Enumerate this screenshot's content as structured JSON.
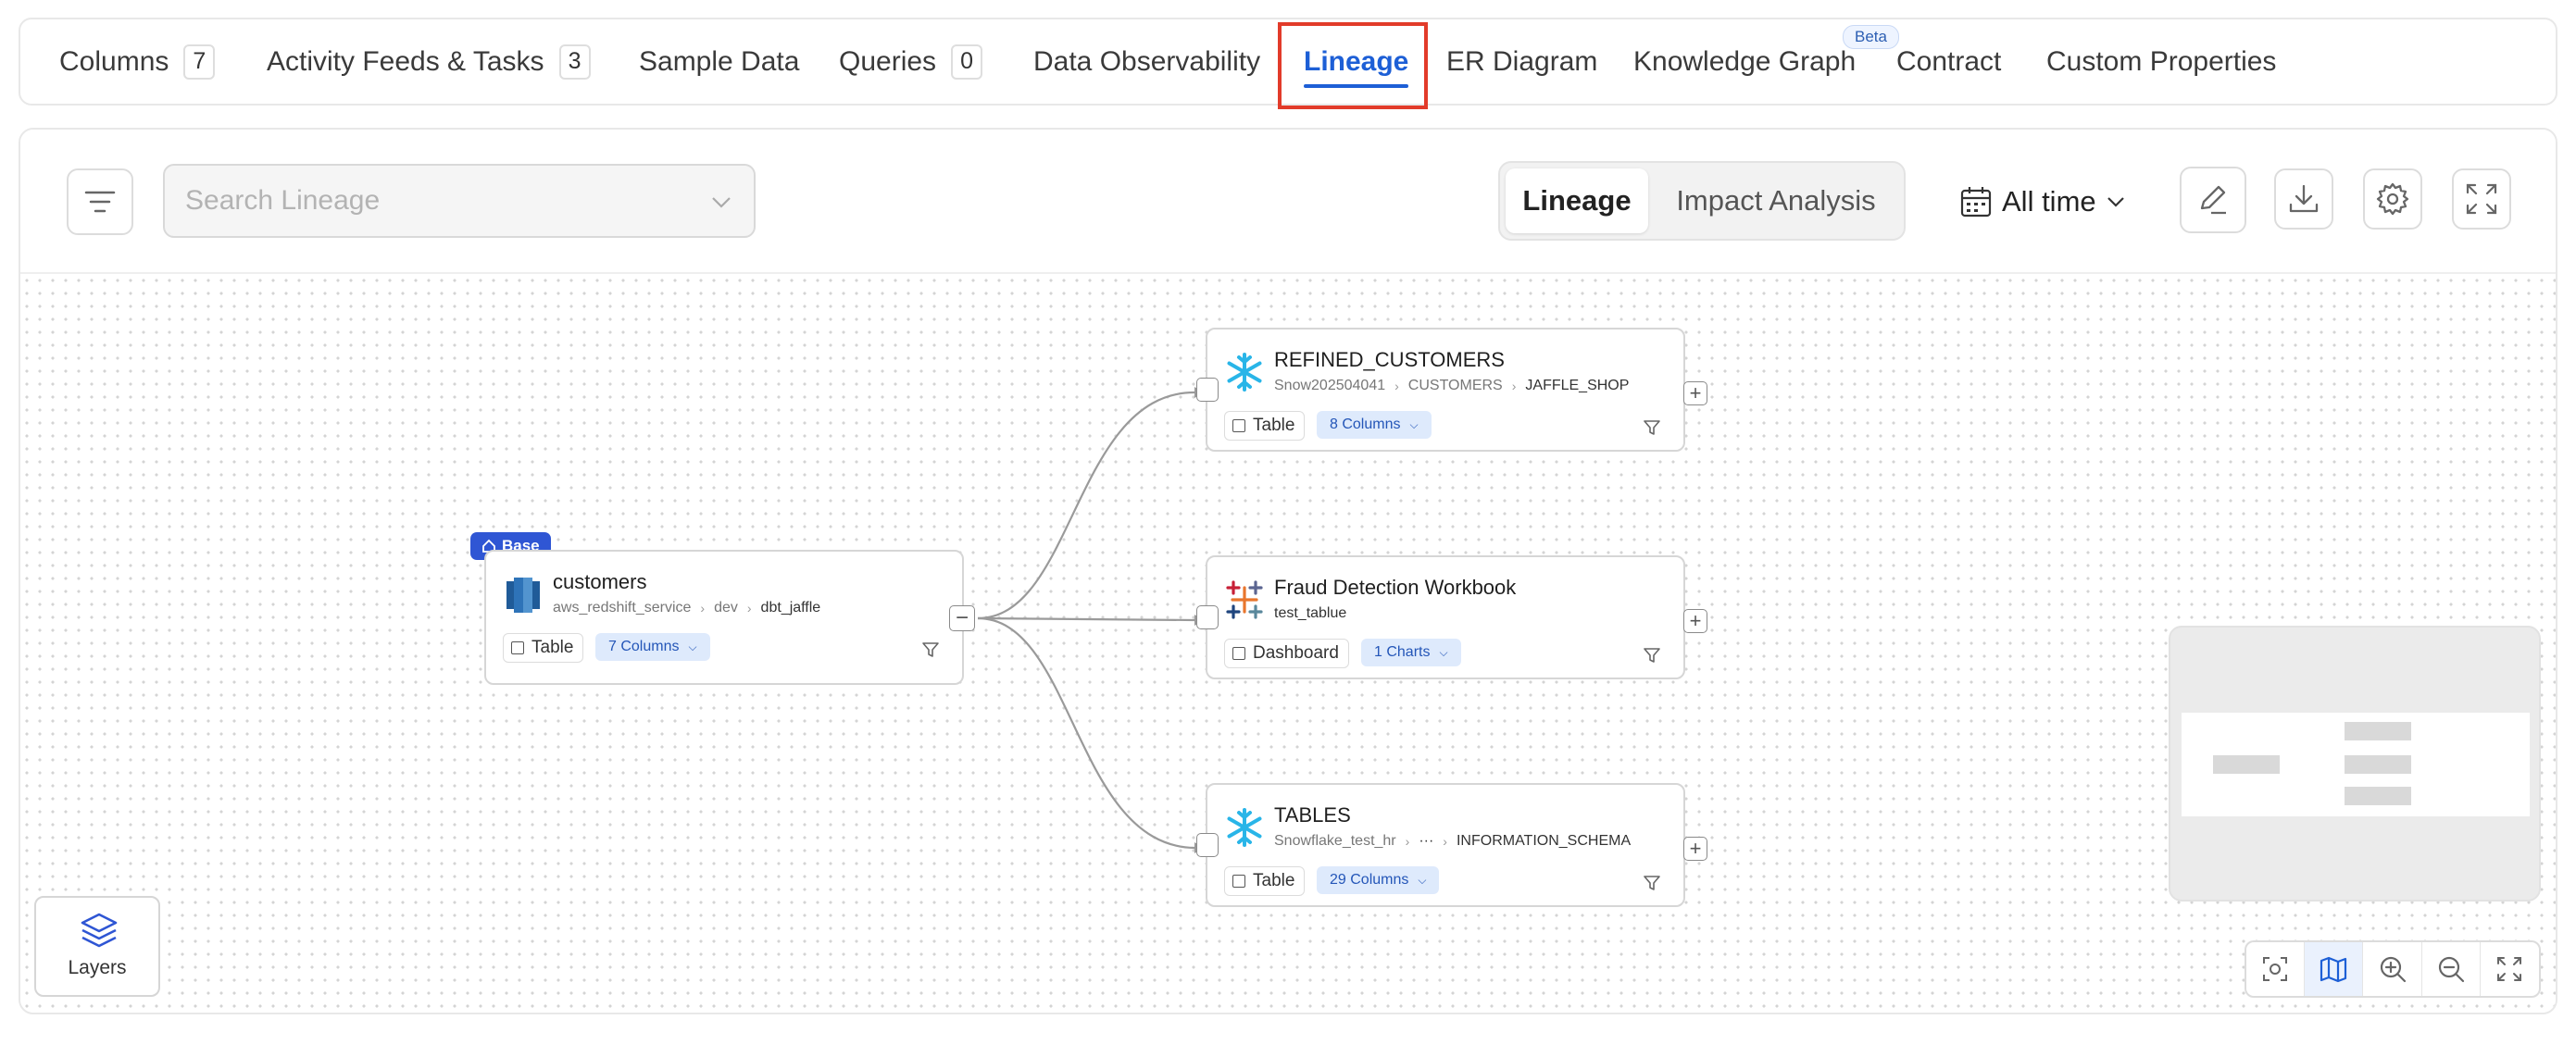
{
  "tabs": [
    {
      "label": "Columns",
      "count": "7"
    },
    {
      "label": "Activity Feeds & Tasks",
      "count": "3"
    },
    {
      "label": "Sample Data"
    },
    {
      "label": "Queries",
      "count": "0"
    },
    {
      "label": "Data Observability"
    },
    {
      "label": "Lineage",
      "active": true
    },
    {
      "label": "ER Diagram"
    },
    {
      "label": "Knowledge Graph",
      "badge": "Beta"
    },
    {
      "label": "Contract"
    },
    {
      "label": "Custom Properties"
    }
  ],
  "toolbar": {
    "search_placeholder": "Search Lineage",
    "view_options": [
      "Lineage",
      "Impact Analysis"
    ],
    "active_view": "Lineage",
    "time_filter": "All time"
  },
  "nodes": {
    "base": {
      "badge": "Base",
      "name": "customers",
      "path": [
        "aws_redshift_service",
        "dev",
        "dbt_jaffle"
      ],
      "type": "Table",
      "columns": "7 Columns",
      "service": "redshift"
    },
    "refined": {
      "name": "REFINED_CUSTOMERS",
      "path": [
        "Snow202504041",
        "CUSTOMERS",
        "JAFFLE_SHOP"
      ],
      "type": "Table",
      "columns": "8 Columns",
      "service": "snowflake"
    },
    "fraud": {
      "name": "Fraud Detection Workbook",
      "path": [
        "test_tablue"
      ],
      "type": "Dashboard",
      "columns": "1 Charts",
      "service": "tableau"
    },
    "tables": {
      "name": "TABLES",
      "path": [
        "Snowflake_test_hr",
        "···",
        "INFORMATION_SCHEMA"
      ],
      "type": "Table",
      "columns": "29 Columns",
      "service": "snowflake"
    }
  },
  "layers_label": "Layers",
  "colors": {
    "accent": "#1d5fd6",
    "highlight": "#e23b2a",
    "base_badge": "#2f56d4",
    "chip_bg": "#deeafc"
  },
  "icons": [
    "filter-icon",
    "chevron-down-icon",
    "calendar-icon",
    "edit-icon",
    "download-icon",
    "gear-icon",
    "fullscreen-icon",
    "layers-icon",
    "fit-view-icon",
    "map-icon",
    "zoom-in-icon",
    "zoom-out-icon",
    "expand-icon"
  ]
}
